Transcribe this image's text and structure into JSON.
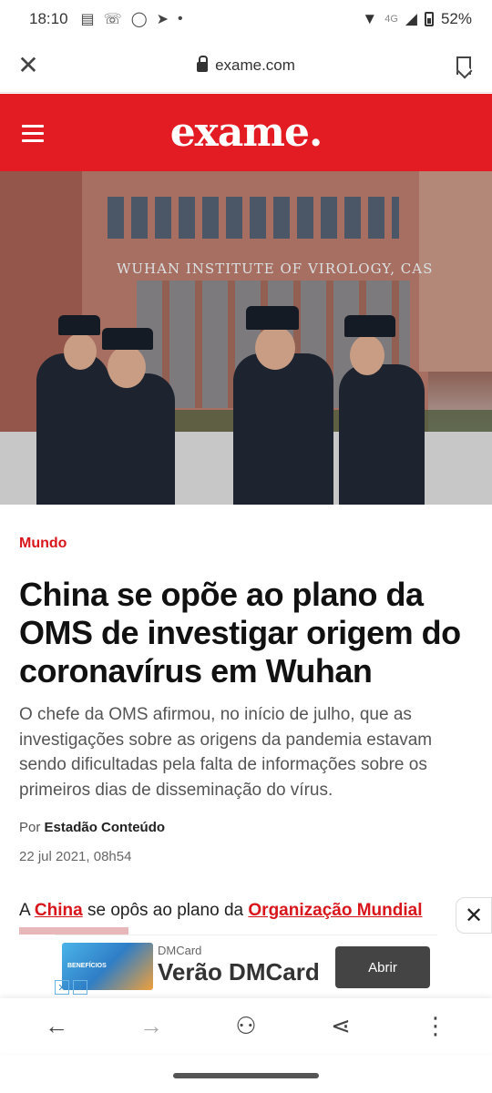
{
  "status_bar": {
    "time": "18:10",
    "network": "4G",
    "battery": "52%"
  },
  "browser": {
    "url": "exame.com"
  },
  "site": {
    "logo": "exame."
  },
  "hero": {
    "sign_text": "WUHAN INSTITUTE OF VIROLOGY, CAS"
  },
  "article": {
    "category": "Mundo",
    "headline": "China se opõe ao plano da OMS de investigar origem do coronavírus em Wuhan",
    "lede": "O chefe da OMS afirmou, no início de julho, que as investigações sobre as origens da pandemia estavam sendo dificultadas pela falta de informações sobre os primeiros dias de disseminação do vírus.",
    "byline_prefix": "Por",
    "author": "Estadão Conteúdo",
    "date": "22 jul 2021, 08h54",
    "body_start": "A",
    "link1": "China",
    "body_mid": "se opôs ao plano da",
    "link2": "Organização Mundial"
  },
  "ad": {
    "brand": "DMCard",
    "title": "Verão DMCard",
    "button": "Abrir",
    "image_caption": "BENEFÍCIOS"
  },
  "icons": {
    "close": "close-icon",
    "lock": "lock-icon",
    "bookmark": "bookmark-icon",
    "menu": "hamburger-icon",
    "back": "arrow-left-icon",
    "forward": "arrow-right-icon",
    "read_aloud": "read-aloud-icon",
    "share": "share-icon",
    "more": "more-vertical-icon"
  }
}
